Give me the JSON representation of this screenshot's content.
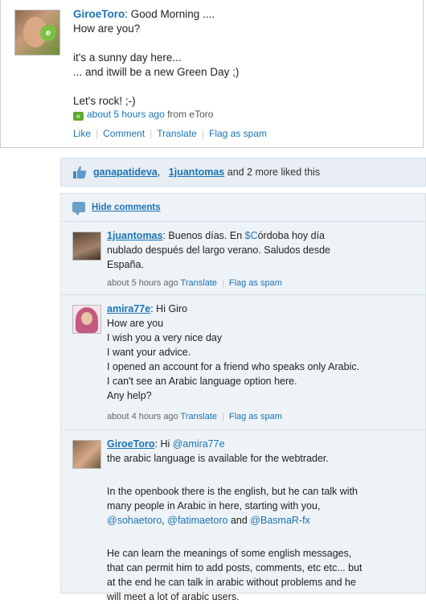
{
  "post": {
    "author": "GiroeToro",
    "lines": [
      ": Good Morning ....",
      "How are you?",
      "",
      "it's a sunny day here...",
      "... and itwill be a new Green Day ;)",
      "",
      "Let's rock! ;-)"
    ],
    "time": "about 5 hours ago",
    "source": "from eToro",
    "actions": [
      "Like",
      "Comment",
      "Translate",
      "Flag as spam"
    ]
  },
  "likes": {
    "user1": "ganapatideva",
    "comma": ",",
    "user2": "1juantomas",
    "rest": "and 2 more liked this"
  },
  "comments_header": {
    "hide_label": "Hide comments"
  },
  "comments": [
    {
      "author": "1juantomas",
      "lines": [
        ": Buenos días. En ",
        "$C",
        "órdoba hoy día",
        "nublado después del largo verano. Saludos desde",
        "España."
      ],
      "time": "about 5 hours ago",
      "translate": "Translate",
      "flag": "Flag as spam"
    },
    {
      "author": "amira77e",
      "lines": [
        ": Hi Giro",
        "How are you",
        "I wish you a very nice day",
        "I want your advice.",
        "I opened an account for a friend who speaks only Arabic.",
        "I can't see an Arabic language option here.",
        "Any help?"
      ],
      "time": "about 4 hours ago",
      "translate": "Translate",
      "flag": "Flag as spam"
    },
    {
      "author": "GiroeToro",
      "intro": ": Hi ",
      "mention": "@amira77e",
      "lines": [
        "the arabic language is available for the webtrader.",
        "",
        "In the openbook there is the english, but he can talk with",
        "many people in Arabic in here, starting with you,"
      ],
      "mentions": [
        "@sohaetoro",
        "@fatimaetoro",
        "@BasmaR-fx"
      ],
      "mention_sep1": ", ",
      "mention_sep2": " and ",
      "lines2": [
        "",
        "He can learn the meanings of some english messages,",
        "that can permit him to add posts, comments, etc etc... but",
        "at the end he can talk in arabic without problems and he",
        "will meet a lot of arabic users."
      ]
    }
  ],
  "colors": {
    "link": "#1a73b6",
    "panel": "#eef3f7",
    "green": "#5aab2a"
  }
}
